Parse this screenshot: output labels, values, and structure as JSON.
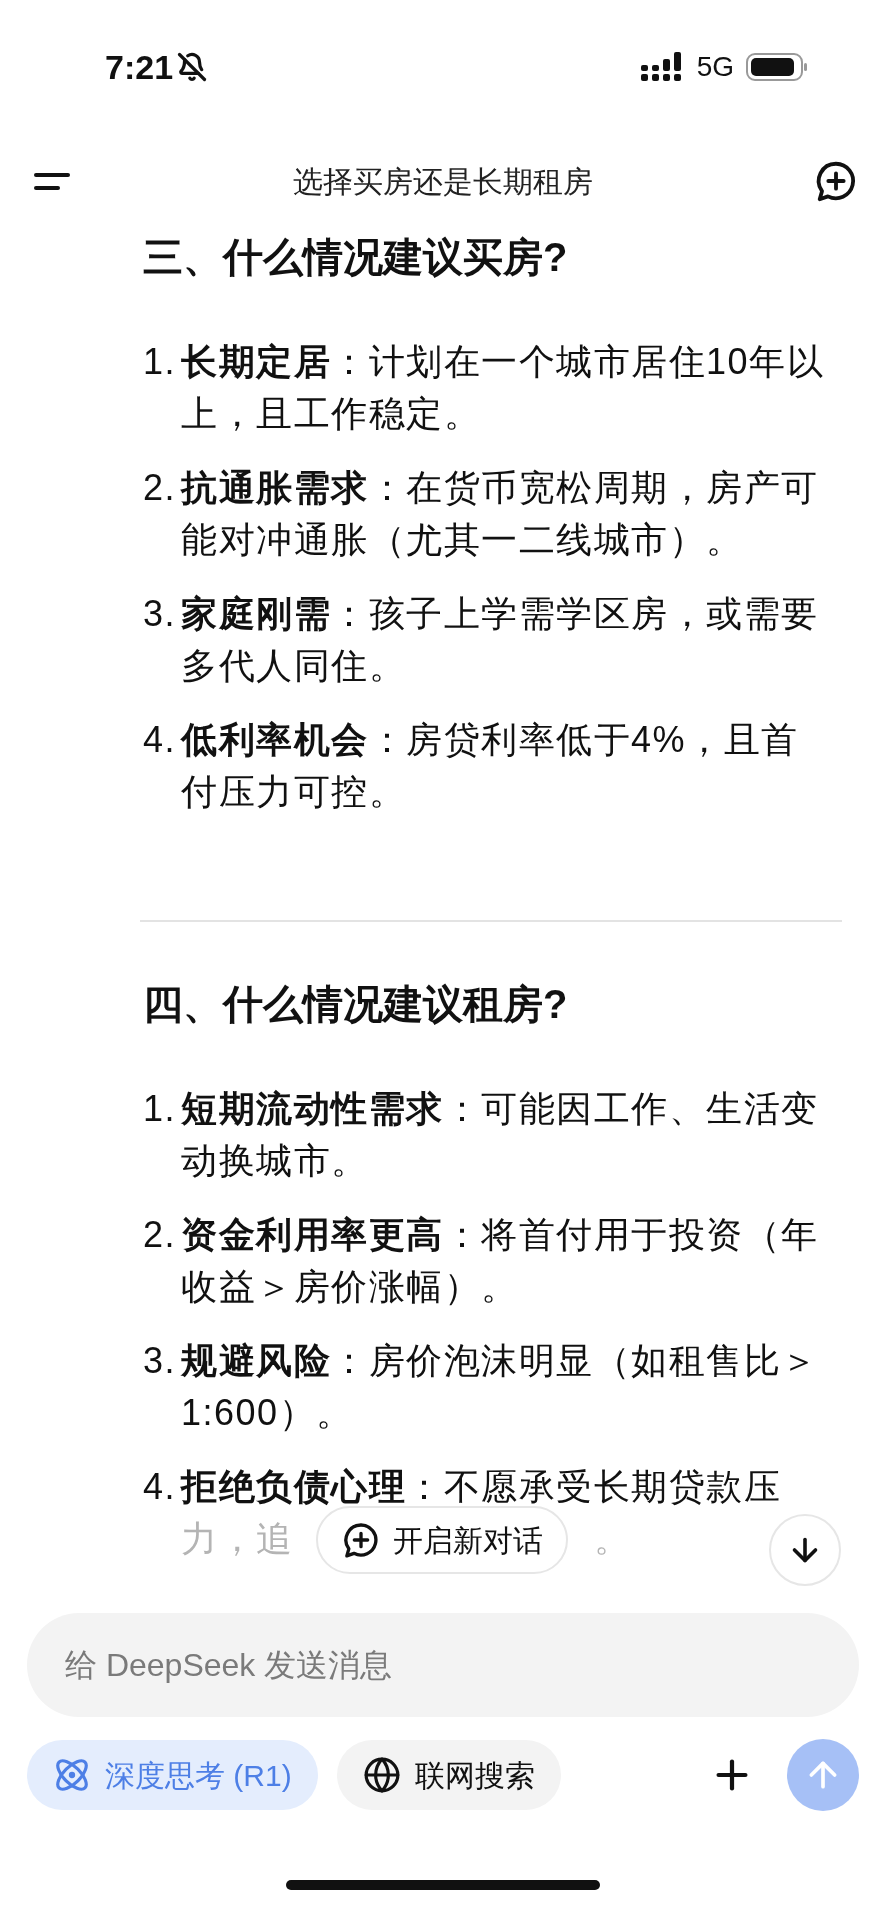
{
  "status_bar": {
    "time": "7:21",
    "network": "5G"
  },
  "header": {
    "title": "选择买房还是长期租房"
  },
  "sections": [
    {
      "heading": "三、什么情况建议买房?",
      "items": [
        {
          "number": "1.",
          "text": "**长期定居**：计划在一个城市居住10年以上，且工作稳定。"
        },
        {
          "number": "2.",
          "text": "**抗通胀需求**：在货币宽松周期，房产可能对冲通胀（尤其一二线城市）。"
        },
        {
          "number": "3.",
          "text": "**家庭刚需**：孩子上学需学区房，或需要多代人同住。"
        },
        {
          "number": "4.",
          "text": "**低利率机会**：房贷利率低于4%，且首付压力可控。"
        }
      ]
    },
    {
      "heading": "四、什么情况建议租房?",
      "items": [
        {
          "number": "1.",
          "text": "**短期流动性需求**：可能因工作、生活变动换城市。"
        },
        {
          "number": "2.",
          "text": "**资金利用率更高**：将首付用于投资（年收益＞房价涨幅）。"
        },
        {
          "number": "3.",
          "text": "**规避风险**：房价泡沫明显（如租售比＞1:600）。"
        },
        {
          "number": "4.",
          "text": "**拒绝负债心理**：不愿承受长期贷款压",
          "continuation": "力，追",
          "tail": "。"
        }
      ]
    }
  ],
  "new_chat_button": {
    "label": "开启新对话"
  },
  "composer": {
    "placeholder": "给 DeepSeek 发送消息",
    "toggles": [
      {
        "label": "深度思考 (R1)",
        "selected": true
      },
      {
        "label": "联网搜索",
        "selected": false
      }
    ],
    "send": {
      "disabled": true
    }
  }
}
